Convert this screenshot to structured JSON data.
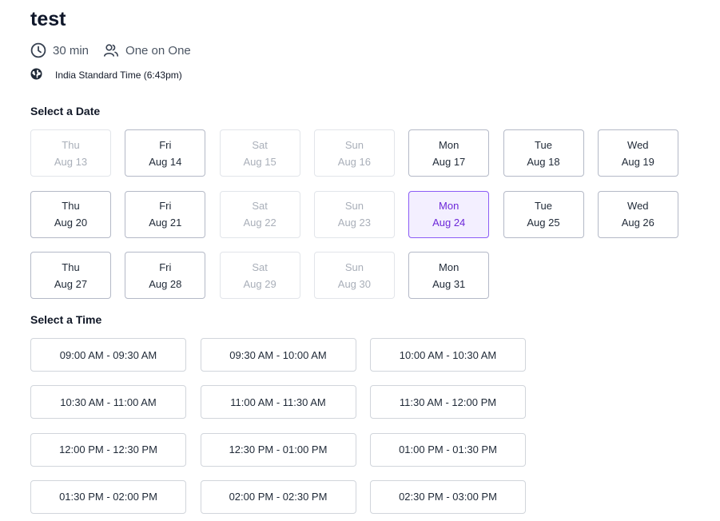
{
  "event": {
    "title": "test",
    "duration": "30 min",
    "meeting_type": "One on One",
    "timezone": "India Standard Time (6:43pm)"
  },
  "icons": {
    "duration": "clock-icon",
    "meeting_type": "users-icon",
    "timezone": "globe-icon"
  },
  "colors": {
    "selected_border": "#8b5cf6",
    "selected_bg": "#f3efff",
    "selected_text": "#6d28d9",
    "available_border": "#b4b9c7",
    "disabled_text": "#a9afb9"
  },
  "date_section": {
    "heading": "Select a Date",
    "dates": [
      {
        "day": "Thu",
        "date": "Aug 13",
        "state": "disabled"
      },
      {
        "day": "Fri",
        "date": "Aug 14",
        "state": "available"
      },
      {
        "day": "Sat",
        "date": "Aug 15",
        "state": "disabled"
      },
      {
        "day": "Sun",
        "date": "Aug 16",
        "state": "disabled"
      },
      {
        "day": "Mon",
        "date": "Aug 17",
        "state": "available"
      },
      {
        "day": "Tue",
        "date": "Aug 18",
        "state": "available"
      },
      {
        "day": "Wed",
        "date": "Aug 19",
        "state": "available"
      },
      {
        "day": "Thu",
        "date": "Aug 20",
        "state": "available"
      },
      {
        "day": "Fri",
        "date": "Aug 21",
        "state": "available"
      },
      {
        "day": "Sat",
        "date": "Aug 22",
        "state": "disabled"
      },
      {
        "day": "Sun",
        "date": "Aug 23",
        "state": "disabled"
      },
      {
        "day": "Mon",
        "date": "Aug 24",
        "state": "selected"
      },
      {
        "day": "Tue",
        "date": "Aug 25",
        "state": "available"
      },
      {
        "day": "Wed",
        "date": "Aug 26",
        "state": "available"
      },
      {
        "day": "Thu",
        "date": "Aug 27",
        "state": "available"
      },
      {
        "day": "Fri",
        "date": "Aug 28",
        "state": "available"
      },
      {
        "day": "Sat",
        "date": "Aug 29",
        "state": "disabled"
      },
      {
        "day": "Sun",
        "date": "Aug 30",
        "state": "disabled"
      },
      {
        "day": "Mon",
        "date": "Aug 31",
        "state": "available"
      }
    ]
  },
  "time_section": {
    "heading": "Select a Time",
    "slots": [
      "09:00 AM - 09:30 AM",
      "09:30 AM - 10:00 AM",
      "10:00 AM - 10:30 AM",
      "10:30 AM - 11:00 AM",
      "11:00 AM - 11:30 AM",
      "11:30 AM - 12:00 PM",
      "12:00 PM - 12:30 PM",
      "12:30 PM - 01:00 PM",
      "01:00 PM - 01:30 PM",
      "01:30 PM - 02:00 PM",
      "02:00 PM - 02:30 PM",
      "02:30 PM - 03:00 PM"
    ]
  }
}
